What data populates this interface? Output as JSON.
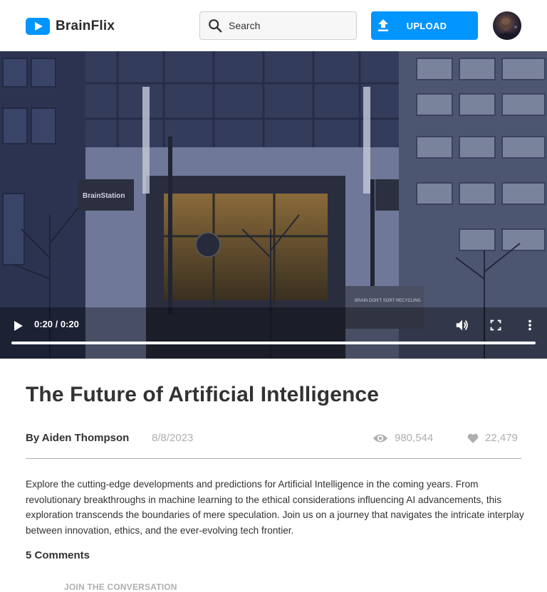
{
  "header": {
    "brand": "BrainFlix",
    "search_placeholder": "Search",
    "upload_label": "UPLOAD",
    "accent_color": "#0095ff"
  },
  "video": {
    "sign_text": "BrainStation",
    "recycling_text": "BRAIN DON'T SORT RECYCLING",
    "time_display": "0:20 / 0:20",
    "progress_fraction": 1.0,
    "icons": [
      "play-icon",
      "volume-icon",
      "fullscreen-icon",
      "more-options-icon"
    ]
  },
  "content": {
    "title": "The Future of Artificial Intelligence",
    "author": "By Aiden Thompson",
    "date": "8/8/2023",
    "views": "980,544",
    "likes": "22,479",
    "description": "Explore the cutting-edge developments and predictions for Artificial Intelligence in the coming years. From revolutionary breakthroughs in machine learning to the ethical considerations influencing AI advancements, this exploration transcends the boundaries of mere speculation. Join us on a journey that navigates the intricate interplay between innovation, ethics, and the ever-evolving tech frontier.",
    "comments_count": "5 Comments",
    "join_label": "JOIN THE CONVERSATION"
  }
}
